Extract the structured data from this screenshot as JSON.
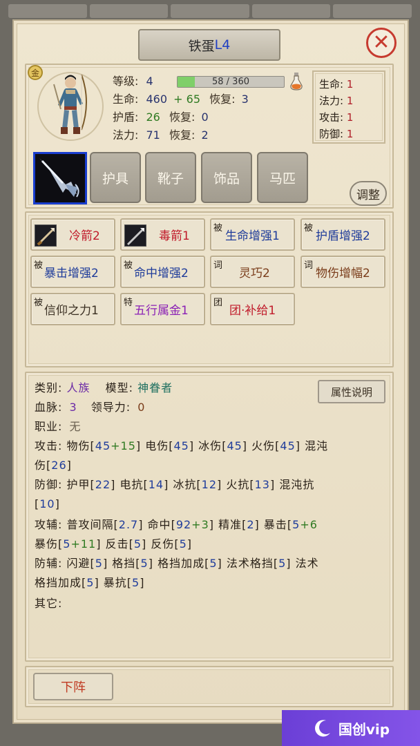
{
  "header": {
    "name": "铁蛋",
    "level": "L4"
  },
  "portrait": {
    "grade_badge": "金"
  },
  "stats": {
    "level_label": "等级:",
    "level_value": "4",
    "exp_text": "58 / 360",
    "exp_fraction": 0.161,
    "hp_label": "生命:",
    "hp_base": "460",
    "hp_plus": "+ 65",
    "hp_regen_label": "恢复:",
    "hp_regen": "3",
    "shield_label": "护盾:",
    "shield_value": "26",
    "shield_regen_label": "恢复:",
    "shield_regen": "0",
    "mp_label": "法力:",
    "mp_value": "71",
    "mp_regen_label": "恢复:",
    "mp_regen": "2"
  },
  "bonus": [
    {
      "label": "生命:",
      "value": "1"
    },
    {
      "label": "法力:",
      "value": "1"
    },
    {
      "label": "攻击:",
      "value": "1"
    },
    {
      "label": "防御:",
      "value": "1"
    }
  ],
  "equipment": {
    "slots": [
      "护具",
      "靴子",
      "饰品",
      "马匹"
    ],
    "adjust_label": "调整"
  },
  "skills": [
    {
      "tag": "",
      "name": "冷箭2"
    },
    {
      "tag": "",
      "name": "毒箭1"
    },
    {
      "tag": "被",
      "name": "生命增强1"
    },
    {
      "tag": "被",
      "name": "护盾增强2"
    },
    {
      "tag": "被",
      "name": "暴击增强2"
    },
    {
      "tag": "被",
      "name": "命中增强2"
    },
    {
      "tag": "词",
      "name": "灵巧2"
    },
    {
      "tag": "词",
      "name": "物伤增幅2"
    },
    {
      "tag": "被",
      "name": "信仰之力1"
    },
    {
      "tag": "特",
      "name": "五行属金1"
    },
    {
      "tag": "团",
      "name": "团·补给1"
    }
  ],
  "info": {
    "category_label": "类别:",
    "category": "人族",
    "model_label": "模型:",
    "model": "神眷者",
    "bloodline_label": "血脉:",
    "bloodline": "3",
    "leadership_label": "领导力:",
    "leadership": "0",
    "job_label": "职业:",
    "job": "无",
    "attack_label": "攻击:",
    "defense_label": "防御:",
    "atk_aux_label": "攻辅:",
    "def_aux_label": "防辅:",
    "other_label": "其它:",
    "attr_button": "属性说明"
  },
  "attack": {
    "phys_label": "物伤",
    "phys_base": "45",
    "phys_plus": "+15",
    "elec_label": "电伤",
    "elec": "45",
    "ice_label": "冰伤",
    "ice": "45",
    "fire_label": "火伤",
    "fire": "45",
    "chaos_label_1": "混沌",
    "chaos_label_2": "伤",
    "chaos": "26"
  },
  "defense": {
    "armor_label": "护甲",
    "armor": "22",
    "elec_res_label": "电抗",
    "elec_res": "14",
    "ice_res_label": "冰抗",
    "ice_res": "12",
    "fire_res_label": "火抗",
    "fire_res": "13",
    "chaos_res_label": "混沌抗",
    "chaos_res": "10"
  },
  "atk_aux": {
    "interval_label": "普攻间隔",
    "interval": "2.7",
    "hit_label": "命中",
    "hit_base": "92",
    "hit_plus": "+3",
    "precision_label": "精准",
    "precision": "2",
    "crit_label": "暴击",
    "crit_base": "5",
    "crit_plus": "+6",
    "crit_dmg_label": "暴伤",
    "crit_dmg_base": "5",
    "crit_dmg_plus": "+11",
    "counter_label": "反击",
    "counter": "5",
    "reflect_label": "反伤",
    "reflect": "5"
  },
  "def_aux": {
    "dodge_label": "闪避",
    "dodge": "5",
    "block_label": "格挡",
    "block": "5",
    "block_bonus_label": "格挡加成",
    "block_bonus": "5",
    "magic_block_label": "法术格挡",
    "magic_block": "5",
    "magic_block_bonus_label_1": "法术",
    "magic_block_bonus_label_2": "格挡加成",
    "magic_block_bonus": "5",
    "crit_res_label": "暴抗",
    "crit_res": "5"
  },
  "footer": {
    "down_label": "下阵"
  },
  "watermark": {
    "text": "国创vip"
  }
}
